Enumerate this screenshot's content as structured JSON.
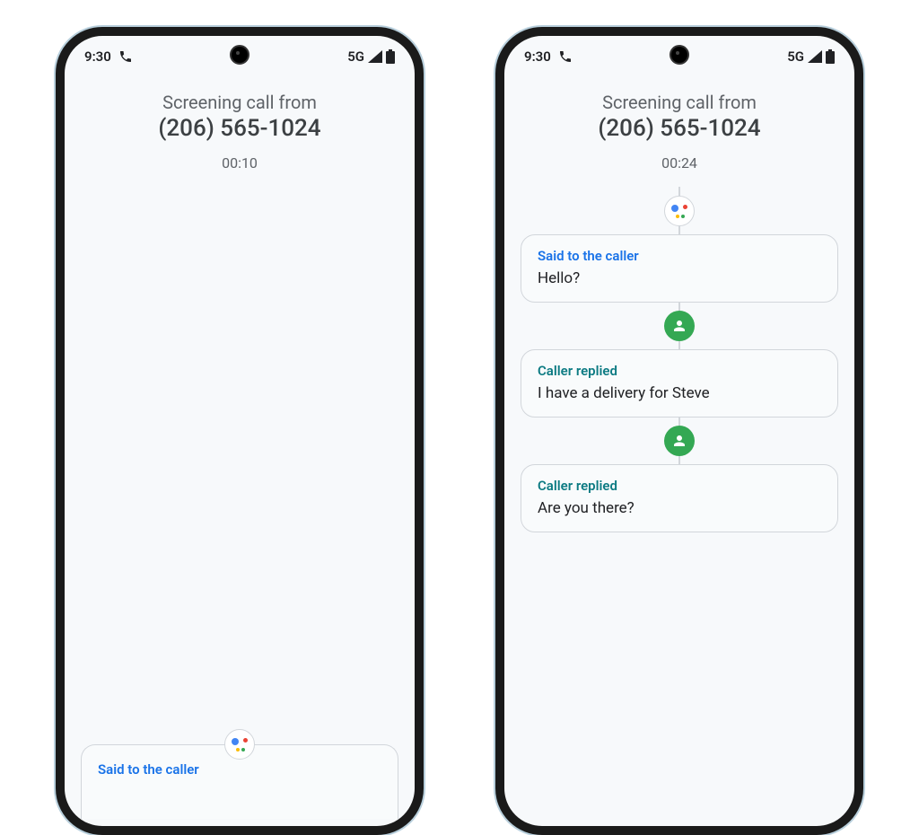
{
  "status": {
    "time": "9:30",
    "network": "5G"
  },
  "header": {
    "label": "Screening call from",
    "phone": "(206) 565-1024"
  },
  "left": {
    "timer": "00:10",
    "card_heading": "Said to the caller"
  },
  "right": {
    "timer": "00:24",
    "cards": [
      {
        "heading": "Said to the caller",
        "body": "Hello?",
        "type": "assistant"
      },
      {
        "heading": "Caller replied",
        "body": "I have a delivery for Steve",
        "type": "caller"
      },
      {
        "heading": "Caller replied",
        "body": "Are you there?",
        "type": "caller"
      }
    ]
  }
}
